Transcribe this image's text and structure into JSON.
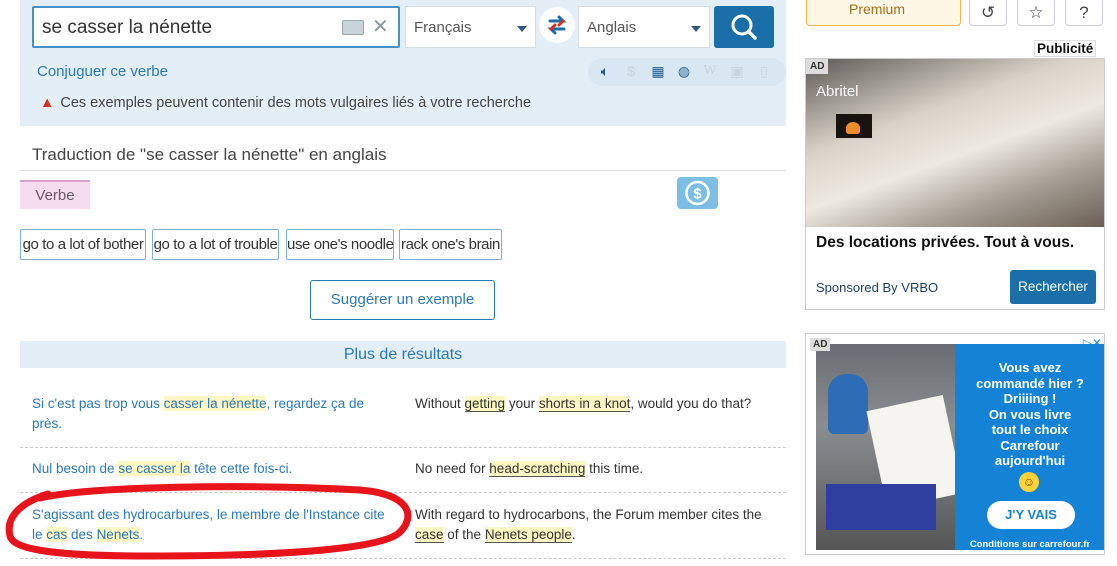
{
  "search": {
    "query": "se casser la nénette",
    "source_lang": "Français",
    "target_lang": "Anglais"
  },
  "links": {
    "conjugate": "Conjuguer ce verbe"
  },
  "warning": "Ces exemples peuvent contenir des mots vulgaires liés à votre recherche",
  "header": {
    "premium_label": "Premium"
  },
  "translation_title": "Traduction de \"se casser la nénette\" en anglais",
  "part_of_speech": "Verbe",
  "translations": [
    {
      "label": "go to a lot of bother"
    },
    {
      "label": "go to a lot of trouble"
    },
    {
      "label": "use one's noodle"
    },
    {
      "label": "rack one's brain"
    }
  ],
  "suggest_button": "Suggérer un exemple",
  "more_results": "Plus de résultats",
  "examples": [
    {
      "source": [
        {
          "t": "Si c'est pas trop vous "
        },
        {
          "t": "casser la nénette",
          "h": true
        },
        {
          "t": ", regardez ça de près."
        }
      ],
      "target": [
        {
          "t": "Without "
        },
        {
          "t": "getting",
          "h": true
        },
        {
          "t": " your "
        },
        {
          "t": "shorts in a knot",
          "h": true
        },
        {
          "t": ", would you do that?"
        }
      ]
    },
    {
      "source": [
        {
          "t": "Nul besoin de "
        },
        {
          "t": "se casser la",
          "h": true
        },
        {
          "t": " tête cette fois-ci."
        }
      ],
      "target": [
        {
          "t": "No need for "
        },
        {
          "t": "head-scratching",
          "h": true
        },
        {
          "t": " this time."
        }
      ]
    },
    {
      "source": [
        {
          "t": "S'agissant des hydrocarbures, le membre de l'Instance cite le "
        },
        {
          "t": "cas",
          "h": true
        },
        {
          "t": " des "
        },
        {
          "t": "Nenets",
          "h": true
        },
        {
          "t": "."
        }
      ],
      "target": [
        {
          "t": "With regard to hydrocarbons, the Forum member cites the "
        },
        {
          "t": "case",
          "h": true
        },
        {
          "t": " of the "
        },
        {
          "t": "Nenets people",
          "h": true
        },
        {
          "t": "."
        }
      ]
    }
  ],
  "ads": {
    "label": "Publicité",
    "badge": "AD",
    "ad1": {
      "brand": "Abritel",
      "headline": "Des locations privées. Tout à vous.",
      "sponsor": "Sponsored By VRBO",
      "cta": "Rechercher"
    },
    "ad2": {
      "text": "Vous avez\ncommandé hier ?\nDriiiing !\nOn vous livre\ntout le choix\nCarrefour\naujourd'hui",
      "cta": "J'Y VAIS",
      "conditions": "Conditions sur carrefour.fr"
    }
  },
  "colors": {
    "accent": "#1a6fa8",
    "highlight": "#fdf7c3",
    "annotation": "#e8141c"
  }
}
